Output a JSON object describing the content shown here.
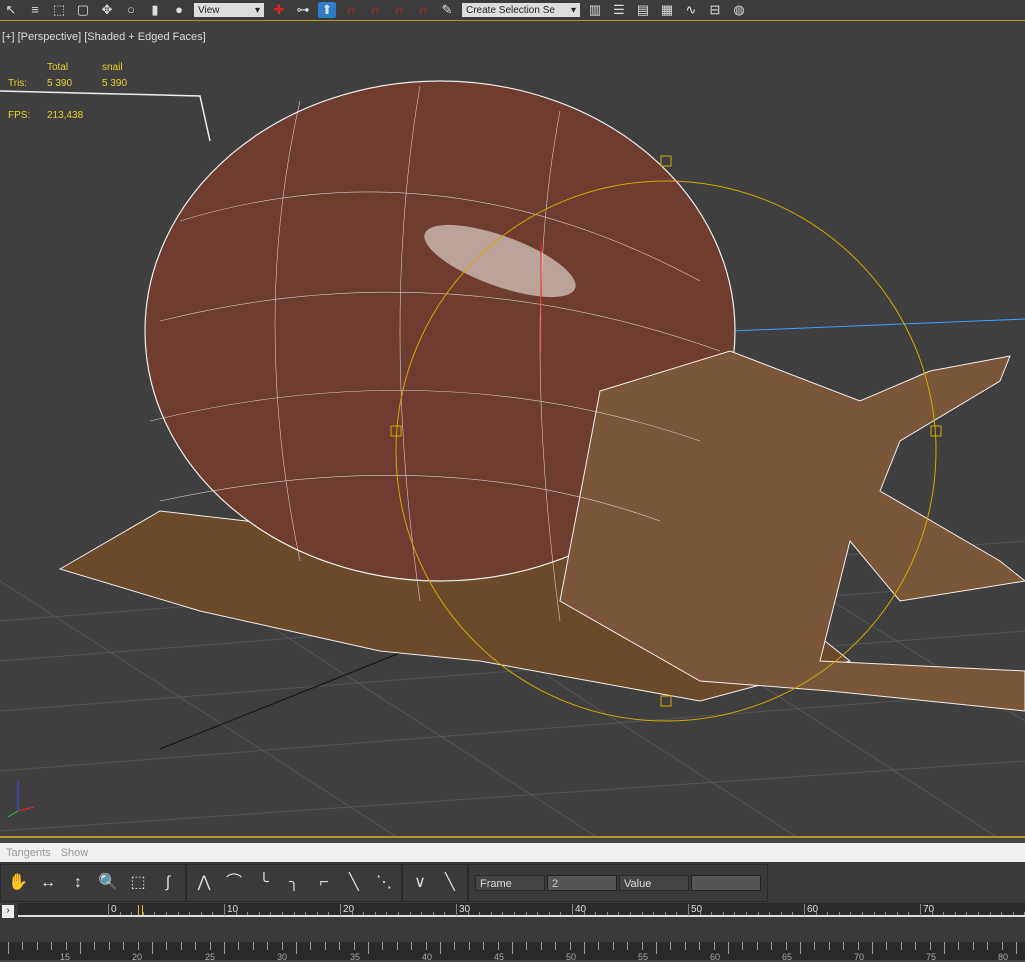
{
  "toolbar": {
    "view_dropdown": "View",
    "selection_set": "Create Selection Se"
  },
  "viewport": {
    "label": "[+] [Perspective] [Shaded + Edged Faces]",
    "stats": {
      "col_total": "Total",
      "col_object": "snail",
      "tris_label": "Tris:",
      "tris_total": "5 390",
      "tris_object": "5 390",
      "fps_label": "FPS:",
      "fps_value": "213,438"
    }
  },
  "curve_editor": {
    "menu": [
      "Tangents",
      "Show"
    ],
    "frame_label": "Frame",
    "frame_value": "2",
    "value_label": "Value",
    "value_value": ""
  },
  "timeline": {
    "ticks": [
      "0",
      "10",
      "20",
      "30",
      "40",
      "50",
      "60",
      "70"
    ],
    "current_frame": 2
  },
  "trackbar": {
    "ticks": [
      "15",
      "20",
      "25",
      "30",
      "35",
      "40",
      "45",
      "50",
      "55",
      "60",
      "65",
      "70",
      "75",
      "80"
    ]
  }
}
